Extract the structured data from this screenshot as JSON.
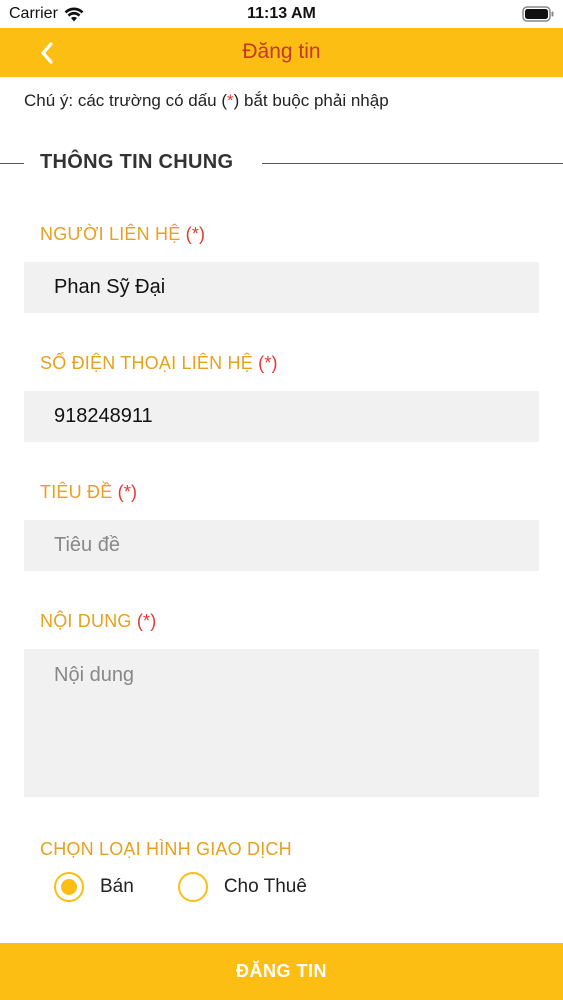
{
  "status_bar": {
    "carrier": "Carrier",
    "time": "11:13 AM"
  },
  "nav": {
    "title": "Đăng tin",
    "back_icon": "chevron-left-icon"
  },
  "note": {
    "prefix": "Chú ý: các trường có dấu (",
    "star": "*",
    "suffix": ") bắt buộc phải nhập"
  },
  "section": {
    "title": "THÔNG TIN CHUNG"
  },
  "fields": {
    "contact_name": {
      "label": "NGƯỜI LIÊN HỆ",
      "required": "(*)",
      "value": "Phan Sỹ Đại"
    },
    "phone": {
      "label": "SỐ ĐIỆN THOẠI LIÊN HỆ",
      "required": "(*)",
      "value": "918248911"
    },
    "title": {
      "label": "TIÊU ĐỀ",
      "required": "(*)",
      "placeholder": "Tiêu đề"
    },
    "content": {
      "label": "NỘI DUNG",
      "required": "(*)",
      "placeholder": "Nội dung"
    }
  },
  "transaction": {
    "label": "CHỌN LOẠI HÌNH GIAO DỊCH",
    "options": [
      {
        "label": "Bán",
        "selected": true
      },
      {
        "label": "Cho Thuê",
        "selected": false
      }
    ]
  },
  "submit_label": "ĐĂNG TIN",
  "colors": {
    "accent": "#FDBE13",
    "title_red": "#C0392B",
    "label_orange": "#E8A020",
    "required_red": "#E53935",
    "field_bg": "#F1F1F1"
  }
}
